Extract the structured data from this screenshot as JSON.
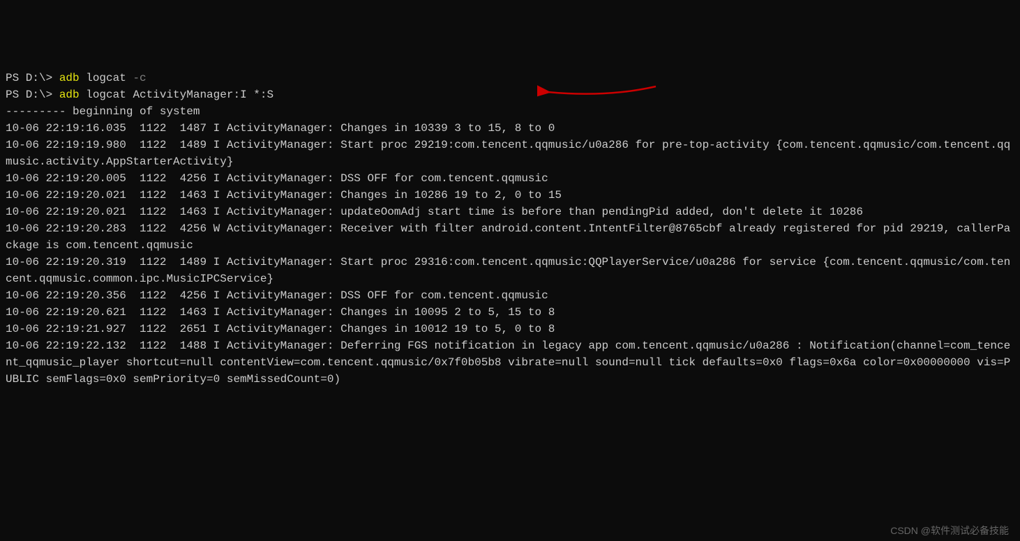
{
  "terminal": {
    "line1_prompt": "PS D:\\> ",
    "line1_cmd": "adb",
    "line1_args": " logcat ",
    "line1_flag": "-c",
    "line2_prompt": "PS D:\\> ",
    "line2_cmd": "adb",
    "line2_args": " logcat ActivityManager:I *:S",
    "output_line1": "--------- beginning of system",
    "output_line2": "10-06 22:19:16.035  1122  1487 I ActivityManager: Changes in 10339 3 to 15, 8 to 0",
    "output_line3": "10-06 22:19:19.980  1122  1489 I ActivityManager: Start proc 29219:com.tencent.qqmusic/u0a286 for pre-top-activity {com.tencent.qqmusic/com.tencent.qqmusic.activity.AppStarterActivity}",
    "output_line4": "10-06 22:19:20.005  1122  4256 I ActivityManager: DSS OFF for com.tencent.qqmusic",
    "output_line5": "10-06 22:19:20.021  1122  1463 I ActivityManager: Changes in 10286 19 to 2, 0 to 15",
    "output_line6": "10-06 22:19:20.021  1122  1463 I ActivityManager: updateOomAdj start time is before than pendingPid added, don't delete it 10286",
    "output_line7": "10-06 22:19:20.283  1122  4256 W ActivityManager: Receiver with filter android.content.IntentFilter@8765cbf already registered for pid 29219, callerPackage is com.tencent.qqmusic",
    "output_line8": "10-06 22:19:20.319  1122  1489 I ActivityManager: Start proc 29316:com.tencent.qqmusic:QQPlayerService/u0a286 for service {com.tencent.qqmusic/com.tencent.qqmusic.common.ipc.MusicIPCService}",
    "output_line9": "10-06 22:19:20.356  1122  4256 I ActivityManager: DSS OFF for com.tencent.qqmusic",
    "output_line10": "10-06 22:19:20.621  1122  1463 I ActivityManager: Changes in 10095 2 to 5, 15 to 8",
    "output_line11": "10-06 22:19:21.927  1122  2651 I ActivityManager: Changes in 10012 19 to 5, 0 to 8",
    "output_line12": "10-06 22:19:22.132  1122  1488 I ActivityManager: Deferring FGS notification in legacy app com.tencent.qqmusic/u0a286 : Notification(channel=com_tencent_qqmusic_player shortcut=null contentView=com.tencent.qqmusic/0x7f0b05b8 vibrate=null sound=null tick defaults=0x0 flags=0x6a color=0x00000000 vis=PUBLIC semFlags=0x0 semPriority=0 semMissedCount=0)"
  },
  "watermark": "CSDN @软件测试必备技能",
  "annotation": {
    "arrow_color": "#cc0000"
  }
}
